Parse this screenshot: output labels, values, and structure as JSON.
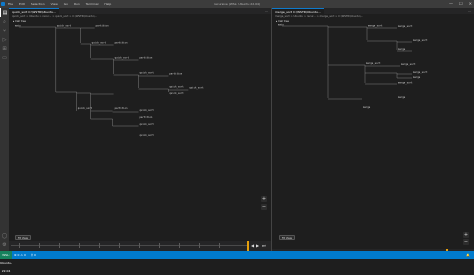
{
  "window": {
    "title": "recursive (WSL: Ubuntu 22.04)",
    "menu": [
      "File",
      "Edit",
      "Selection",
      "View",
      "Go",
      "Run",
      "Terminal",
      "Help"
    ],
    "controls": [
      "—",
      "☐",
      "✕"
    ]
  },
  "activity_bar": {
    "icons": [
      "files-icon",
      "search-icon",
      "source-control-icon",
      "run-debug-icon",
      "extensions-icon",
      "remote-explorer-icon"
    ],
    "bottom_icons": [
      "account-icon",
      "settings-gear-icon"
    ]
  },
  "left_pane": {
    "tab": "quick_sort C:\\WSTR\\Ubuntu...",
    "breadcrumb": "quick_sort > Ubuntu > recur... > quick_sort > C:\\WSTR\\Ubuntu\\...",
    "header": "▸ Call tree",
    "root": "main",
    "nodes": [
      "quick_sort",
      "partition",
      "quick_sort",
      "partition",
      "quick_sort",
      "partition",
      "quick_sort",
      "partition",
      "quick_sort",
      "quick_sort",
      "quick_sort",
      "quick_sort",
      "partition",
      "quick_sort",
      "partition",
      "quick_sort",
      "quick_sort"
    ],
    "fit_button": "Fit View",
    "zoom_in": "+",
    "zoom_out": "−"
  },
  "right_pane": {
    "tab": "merge_sort C:\\WSTR\\Ubuntu...",
    "breadcrumb": "merge_sort > Ubuntu > recur... > merge_sort > C:\\WSTR\\Ubuntu\\...",
    "header": "▸ Call tree",
    "root": "main",
    "nodes": [
      "merge_sort",
      "merge_sort",
      "merge_sort",
      "merge",
      "merge_sort",
      "merge_sort",
      "merge_sort",
      "merge",
      "merge_sort",
      "merge",
      "merge"
    ],
    "fit_button": "Fit View",
    "zoom_in": "+",
    "zoom_out": "−"
  },
  "timeline": {
    "controls": [
      "⏮",
      "◀",
      "▶",
      "⏭"
    ]
  },
  "statusbar": {
    "remote": "WSL: Ubuntu-22.04",
    "items": [
      "⊗ 0 ⚠ 0",
      "⚲ 0"
    ],
    "right": "🔔"
  },
  "colors": {
    "accent": "#007acc",
    "edge": "#9a9a9a",
    "timeline_marker": "#e5a00d"
  }
}
